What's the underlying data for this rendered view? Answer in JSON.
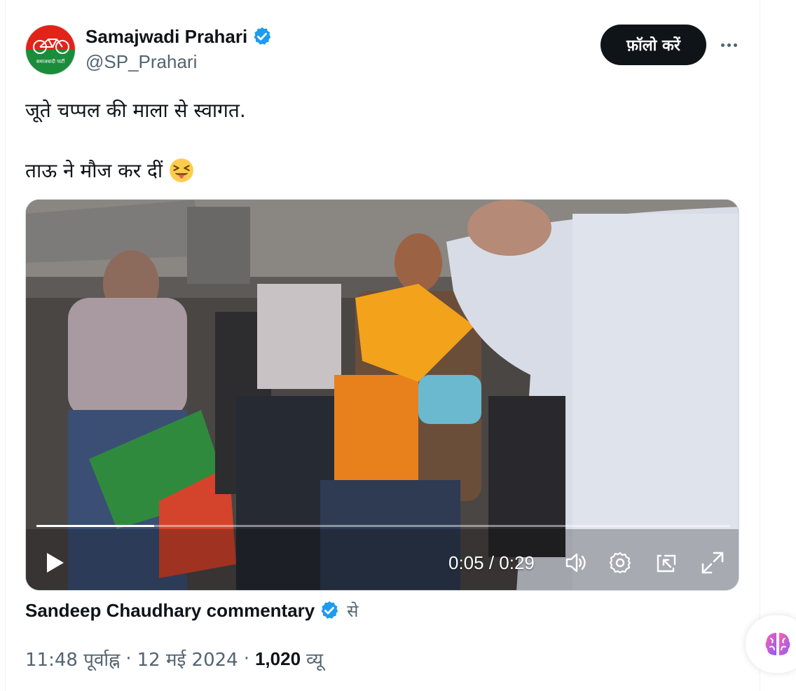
{
  "author": {
    "display_name": "Samajwadi Prahari",
    "handle": "@SP_Prahari",
    "avatar_text": "समाजवादी पार्टी",
    "verified_icon": "verified-badge-icon"
  },
  "actions": {
    "follow_label": "फ़ॉलो करें",
    "more_icon": "more-dots-icon"
  },
  "tweet": {
    "line1": "जूते चप्पल की माला से स्वागत.",
    "line2": "ताऊ ने मौज कर दीं",
    "emoji": "squinting-face-with-tongue-emoji"
  },
  "video": {
    "time_display": "0:05 / 0:29",
    "progress_fraction": 0.17,
    "controls": [
      "play-icon",
      "volume-icon",
      "settings-gear-icon",
      "pip-icon",
      "fullscreen-icon"
    ]
  },
  "attribution": {
    "source_name": "Sandeep Chaudhary commentary",
    "from_suffix": "से"
  },
  "meta": {
    "time": "11:48 पूर्वाह्न",
    "separator": "·",
    "date": "12 मई 2024",
    "views_count": "1,020",
    "views_label": "व्यू"
  },
  "colors": {
    "accent_blue": "#1d9bf0",
    "text_primary": "#0f1419",
    "text_secondary": "#536471",
    "follow_bg": "#0f1419"
  }
}
